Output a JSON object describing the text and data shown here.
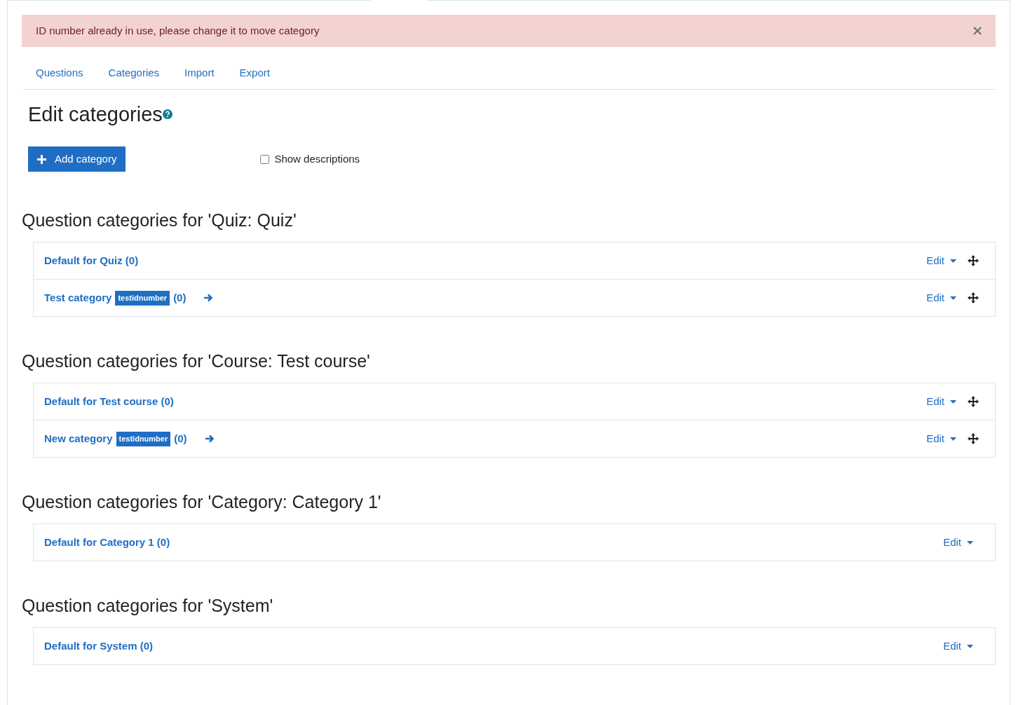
{
  "alert": {
    "message": "ID number already in use, please change it to move category"
  },
  "tabs": [
    {
      "label": "Questions",
      "selected": false
    },
    {
      "label": "Categories",
      "selected": false
    },
    {
      "label": "Import",
      "selected": false
    },
    {
      "label": "Export",
      "selected": false
    }
  ],
  "title": "Edit categories",
  "add_button": "Add category",
  "show_descriptions": {
    "label": "Show descriptions",
    "checked": false
  },
  "sections": [
    {
      "heading": "Question categories for 'Quiz: Quiz'",
      "categories": [
        {
          "name": "Default for Quiz",
          "count": "(0)",
          "move_arrow": false,
          "draggable": true,
          "edit": "Edit"
        },
        {
          "name": "Test category",
          "idnumber": "testidnumber",
          "count": "(0)",
          "move_arrow": true,
          "draggable": true,
          "edit": "Edit"
        }
      ]
    },
    {
      "heading": "Question categories for 'Course: Test course'",
      "categories": [
        {
          "name": "Default for Test course",
          "count": "(0)",
          "move_arrow": false,
          "draggable": true,
          "edit": "Edit"
        },
        {
          "name": "New category",
          "idnumber": "testidnumber",
          "count": "(0)",
          "move_arrow": true,
          "draggable": true,
          "edit": "Edit"
        }
      ]
    },
    {
      "heading": "Question categories for 'Category: Category 1'",
      "categories": [
        {
          "name": "Default for Category 1",
          "count": "(0)",
          "move_arrow": false,
          "draggable": false,
          "edit": "Edit"
        }
      ]
    },
    {
      "heading": "Question categories for 'System'",
      "categories": [
        {
          "name": "Default for System",
          "count": "(0)",
          "move_arrow": false,
          "draggable": false,
          "edit": "Edit"
        }
      ]
    }
  ]
}
